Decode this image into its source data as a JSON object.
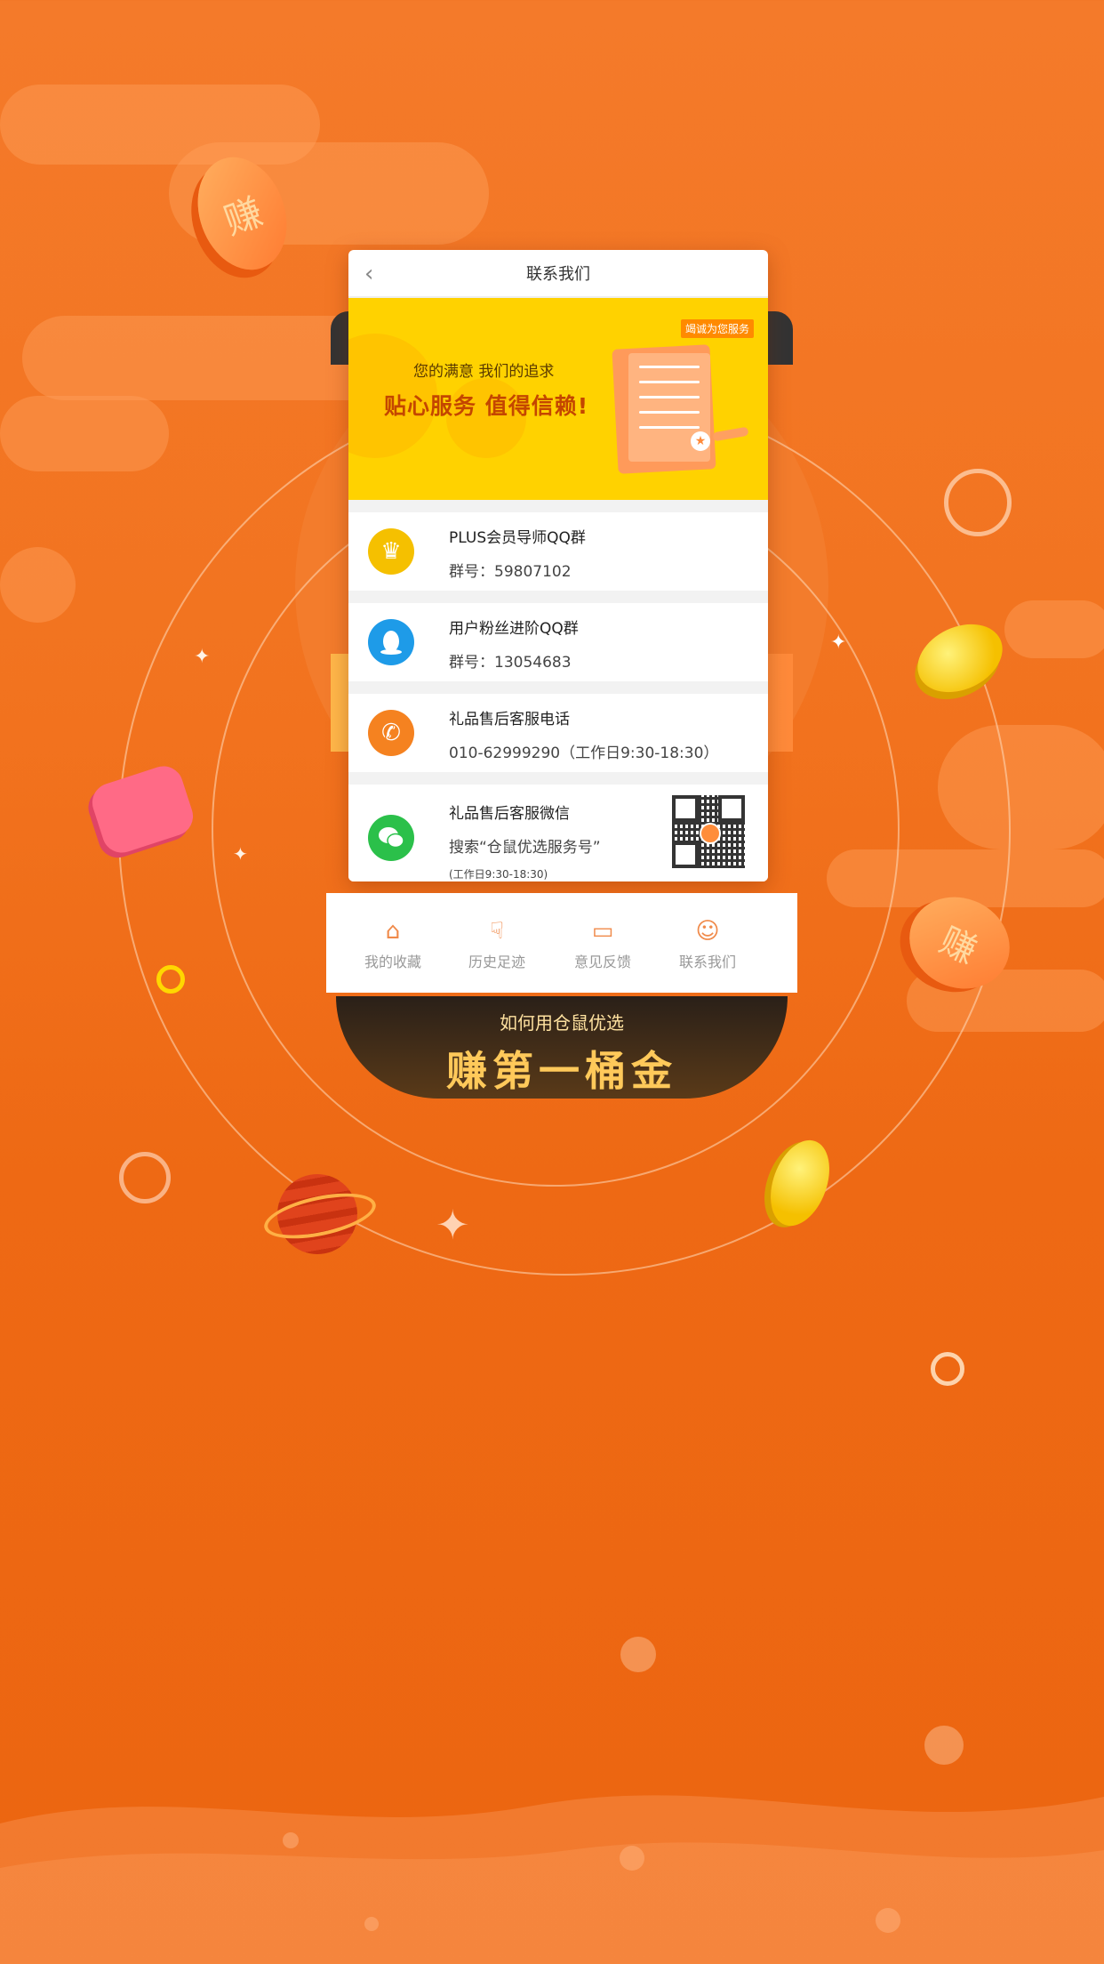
{
  "header": {
    "title": "联系我们"
  },
  "banner": {
    "tag": "竭诚为您服务",
    "subtitle": "您的满意 我们的追求",
    "headline": "贴心服务 值得信赖!"
  },
  "contacts": [
    {
      "icon": "crown-icon",
      "title": "PLUS会员导师QQ群",
      "detail": "群号：59807102",
      "color": "#f5c000"
    },
    {
      "icon": "qq-penguin-icon",
      "title": "用户粉丝进阶QQ群",
      "detail": "群号：13054683",
      "color": "#1e9be8"
    },
    {
      "icon": "phone-icon",
      "title": "礼品售后客服电话",
      "detail": "010-62999290（工作日9:30-18:30）",
      "color": "#f58220"
    },
    {
      "icon": "wechat-icon",
      "title": "礼品售后客服微信",
      "detail": "搜索“仓鼠优选服务号”",
      "note": "(工作日9:30-18:30)",
      "color": "#2bc04a"
    }
  ],
  "tabbar": [
    {
      "icon": "favorite-box-icon",
      "label": "我的收藏"
    },
    {
      "icon": "footprint-icon",
      "label": "历史足迹"
    },
    {
      "icon": "feedback-icon",
      "label": "意见反馈"
    },
    {
      "icon": "customer-service-icon",
      "label": "联系我们"
    }
  ],
  "promo": {
    "line1": "如何用仓鼠优选",
    "line2": "赚第一桶金"
  },
  "decor": {
    "coin_char": "赚"
  }
}
